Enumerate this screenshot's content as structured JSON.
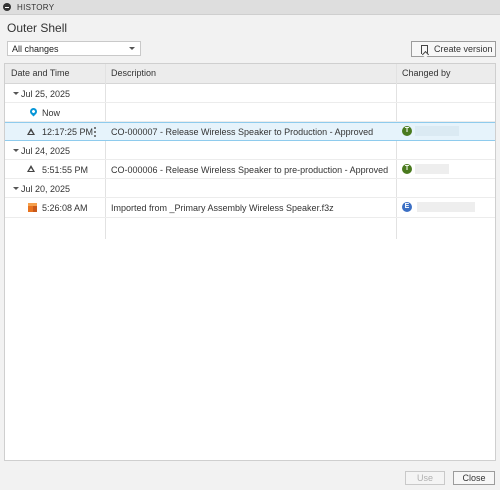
{
  "panel": {
    "title": "HISTORY"
  },
  "document": {
    "title": "Outer Shell"
  },
  "filter": {
    "selected": "All changes"
  },
  "toolbar": {
    "create_version_label": "Create version"
  },
  "table": {
    "columns": {
      "date": "Date and Time",
      "description": "Description",
      "changed_by": "Changed by"
    },
    "groups": [
      {
        "date": "Jul 25, 2025",
        "rows": [
          {
            "time": "Now",
            "icon": "location-pin-icon",
            "description": "",
            "avatar": ""
          },
          {
            "time": "12:17:25 PM",
            "icon": "milestone-triangle-icon",
            "description": "CO-000007 - Release Wireless Speaker to Production - Approved",
            "avatar": "T",
            "avatar_color": "#4a7a1e",
            "selected": true
          }
        ]
      },
      {
        "date": "Jul 24, 2025",
        "rows": [
          {
            "time": "5:51:55 PM",
            "icon": "milestone-triangle-icon",
            "description": "CO-000006 - Release Wireless Speaker to pre-production - Approved",
            "avatar": "T",
            "avatar_color": "#4a7a1e"
          }
        ]
      },
      {
        "date": "Jul 20, 2025",
        "rows": [
          {
            "time": "5:26:08 AM",
            "icon": "component-cube-icon",
            "description": "Imported from _Primary Assembly Wireless Speaker.f3z",
            "avatar": "E",
            "avatar_color": "#3b6fc4"
          }
        ]
      }
    ]
  },
  "footer": {
    "use_label": "Use",
    "close_label": "Close"
  }
}
